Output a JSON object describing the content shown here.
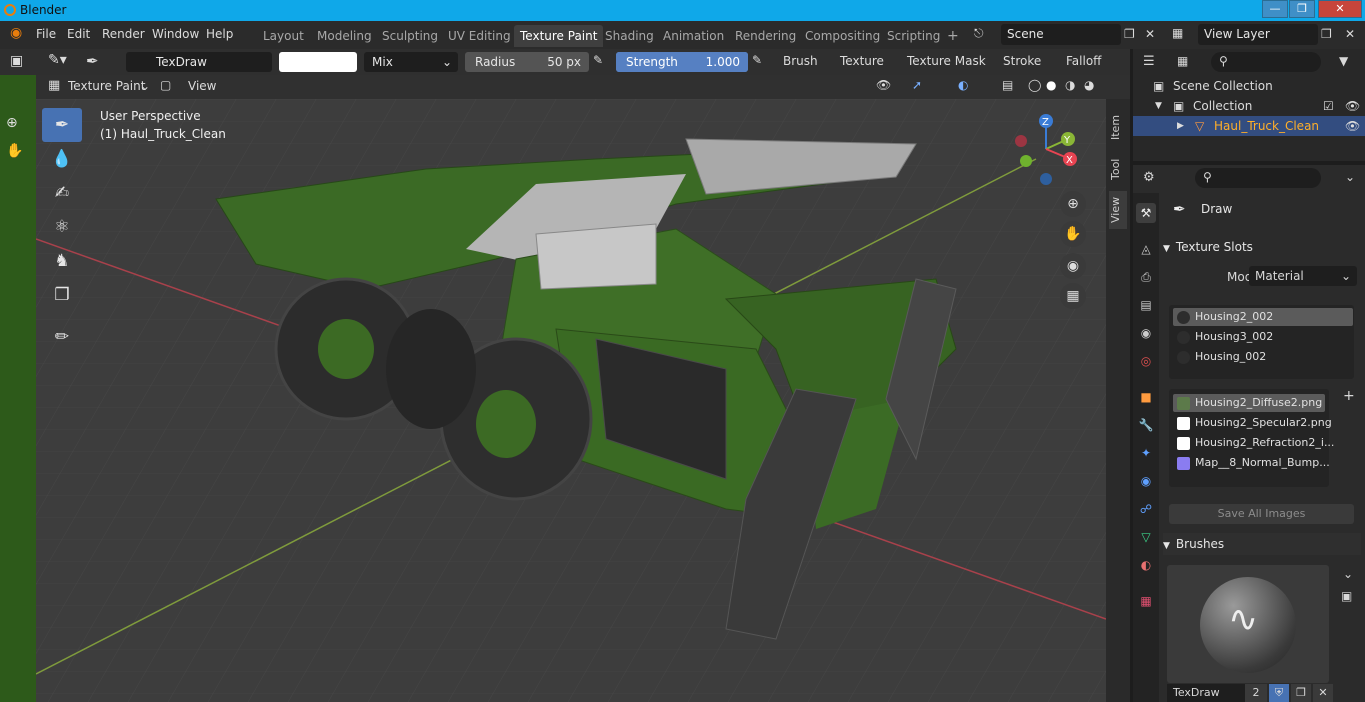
{
  "window": {
    "title": "Blender"
  },
  "menu": {
    "file": "File",
    "edit": "Edit",
    "render": "Render",
    "window": "Window",
    "help": "Help"
  },
  "workspaces": [
    "Layout",
    "Modeling",
    "Sculpting",
    "UV Editing",
    "Texture Paint",
    "Shading",
    "Animation",
    "Rendering",
    "Compositing",
    "Scripting"
  ],
  "scene": {
    "name": "Scene",
    "view_layer": "View Layer"
  },
  "tool_header": {
    "brush_name": "TexDraw",
    "blend_mode": "Mix",
    "radius_label": "Radius",
    "radius_value": "50 px",
    "strength_label": "Strength",
    "strength_value": "1.000",
    "strength_fraction": 1.0,
    "brush": "Brush",
    "texture": "Texture",
    "texture_mask": "Texture Mask",
    "stroke": "Stroke",
    "falloff": "Falloff"
  },
  "viewport_header": {
    "mode": "Texture Paint",
    "view": "View"
  },
  "viewport": {
    "perspective": "User Perspective",
    "object": "(1) Haul_Truck_Clean",
    "axes": {
      "z": "Z",
      "y": "Y",
      "x": "X"
    },
    "side_tabs": [
      "Item",
      "Tool",
      "View"
    ]
  },
  "outliner": {
    "scene_collection": "Scene Collection",
    "collection": "Collection",
    "object": "Haul_Truck_Clean"
  },
  "properties": {
    "tool_name": "Draw",
    "texture_slots": {
      "title": "Texture Slots",
      "mode_label": "Mode",
      "mode_value": "Material",
      "materials": [
        "Housing2_002",
        "Housing3_002",
        "Housing_002"
      ],
      "images": [
        "Housing2_Diffuse2.png",
        "Housing2_Specular2.png",
        "Housing2_Refraction2_i...",
        "Map__8_Normal_Bump..."
      ],
      "save_all": "Save All Images"
    },
    "brushes": {
      "title": "Brushes",
      "name": "TexDraw",
      "users": "2"
    }
  },
  "colors": {
    "accent_blue": "#4772b3",
    "slider_blue": "#5680c2",
    "selected_orange": "#ffaf29",
    "titlebar": "#0fa8e9"
  }
}
